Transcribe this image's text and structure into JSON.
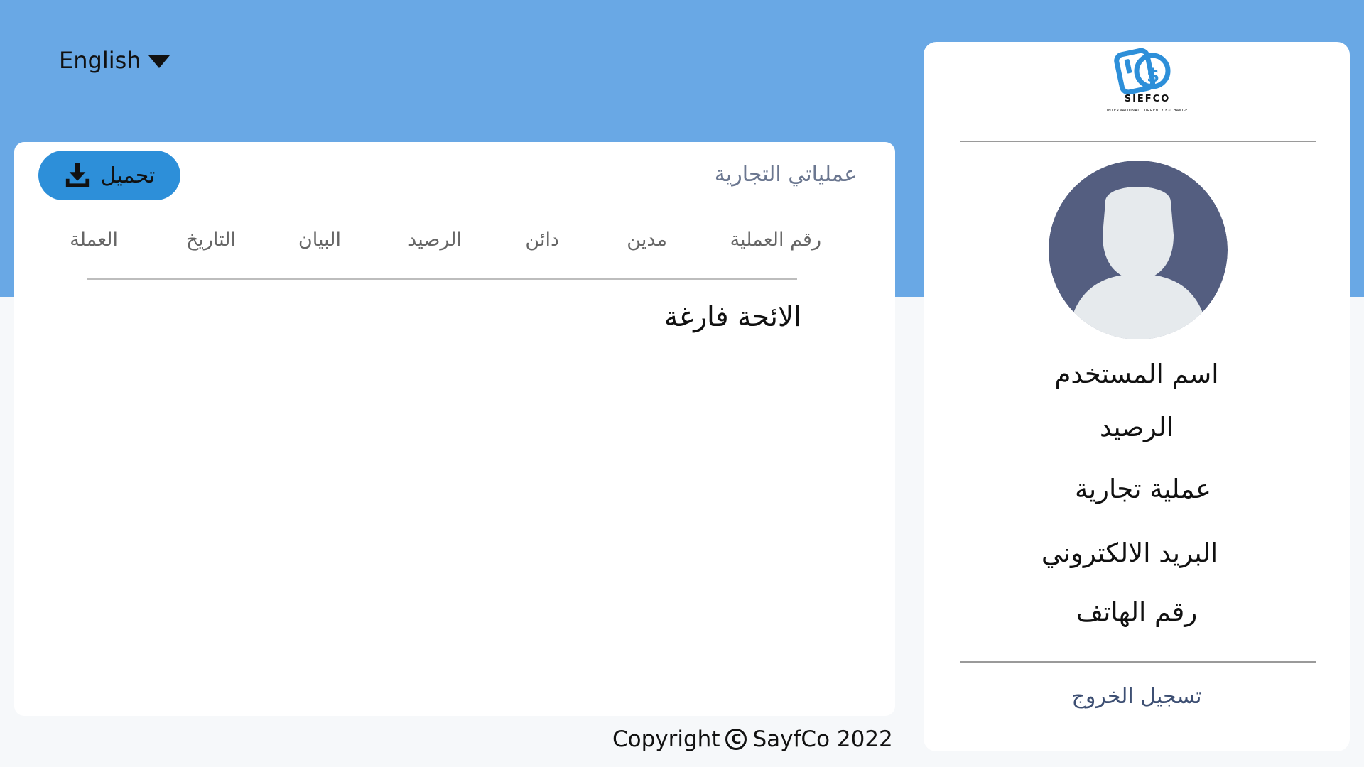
{
  "language": {
    "label": "English"
  },
  "main": {
    "title": "عملياتي  التجارية",
    "download_label": "تحميل",
    "columns": [
      "رقم العملية",
      "مدين",
      "دائن",
      "الرصيد",
      "البيان",
      "التاريخ",
      "العملة"
    ],
    "empty_message": "الائحة فارغة"
  },
  "footer": {
    "prefix": "Copyright",
    "copyright_symbol": "C",
    "suffix": "SayfCo 2022"
  },
  "sidebar": {
    "logo_text": "SIEFCO",
    "logo_subtitle": "INTERNATIONAL CURRENCY EXCHANGE",
    "username": "اسم  المستخدم",
    "balance": "الرصيد",
    "transaction": "عملية تجارية",
    "email": "البريد الالكتروني",
    "phone": "رقم الهاتف",
    "logout": "تسجيل الخروج"
  },
  "colors": {
    "header_band": "#69a8e5",
    "download_button": "#2d8fd9",
    "avatar_background": "#545e80",
    "avatar_figure": "#e6eaed"
  },
  "icons": [
    "chevron-down-icon",
    "download-icon",
    "copyright-icon",
    "avatar-icon",
    "logo-icon"
  ]
}
